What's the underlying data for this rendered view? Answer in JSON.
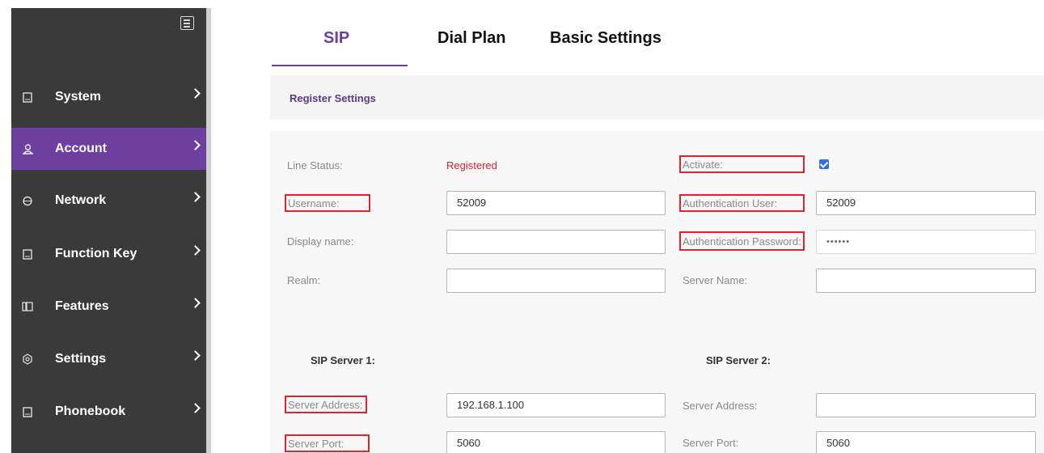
{
  "sidebar": {
    "items": [
      {
        "label": "System",
        "icon": "document-icon"
      },
      {
        "label": "Account",
        "icon": "user-icon"
      },
      {
        "label": "Network",
        "icon": "globe-icon"
      },
      {
        "label": "Function Key",
        "icon": "document-icon"
      },
      {
        "label": "Features",
        "icon": "features-icon"
      },
      {
        "label": "Settings",
        "icon": "gear-icon"
      },
      {
        "label": "Phonebook",
        "icon": "document-icon"
      }
    ],
    "active": "Account"
  },
  "tabs": [
    "SIP",
    "Dial Plan",
    "Basic Settings"
  ],
  "active_tab": "SIP",
  "section": {
    "title": "Register Settings"
  },
  "form": {
    "line_status_label": "Line Status:",
    "line_status_value": "Registered",
    "activate_label": "Activate:",
    "activate_checked": true,
    "username_label": "Username:",
    "username_value": "52009",
    "auth_user_label": "Authentication User:",
    "auth_user_value": "52009",
    "display_name_label": "Display name:",
    "display_name_value": "",
    "auth_password_label": "Authentication Password:",
    "auth_password_value": "••••••",
    "realm_label": "Realm:",
    "realm_value": "",
    "server_name_label": "Server Name:",
    "server_name_value": ""
  },
  "sip_server_1": {
    "title": "SIP Server 1:",
    "address_label": "Server Address:",
    "address_value": "192.168.1.100",
    "port_label": "Server Port:",
    "port_value": "5060"
  },
  "sip_server_2": {
    "title": "SIP Server 2:",
    "address_label": "Server Address:",
    "address_value": "",
    "port_label": "Server Port:",
    "port_value": "5060"
  },
  "colors": {
    "accent": "#6a3ea2",
    "sidebar": "#3a3a3a",
    "status_red": "#d9252c",
    "highlight_box": "#e0242e"
  }
}
